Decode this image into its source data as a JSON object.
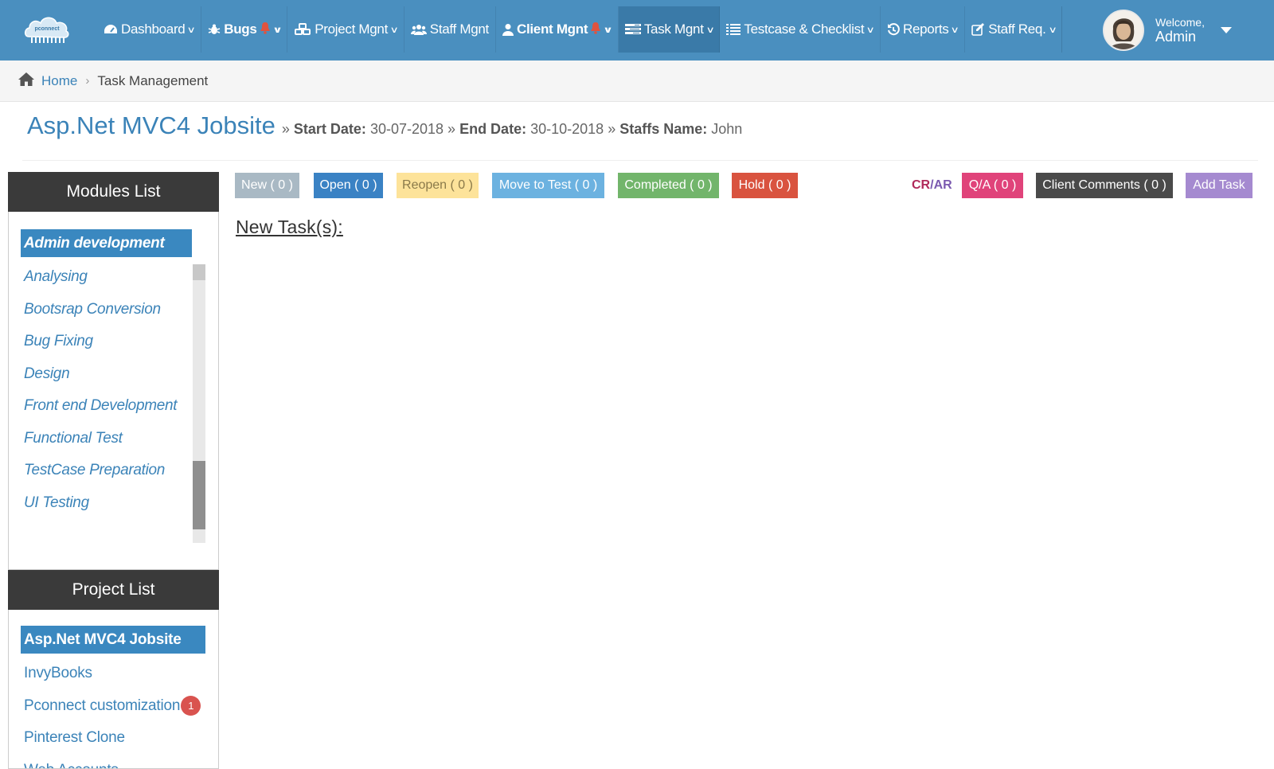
{
  "app": {
    "logo_text": "pconnect"
  },
  "nav": {
    "items": [
      {
        "label": "Dashboard",
        "icon": "dashboard-icon"
      },
      {
        "label": "Bugs",
        "icon": "bug-icon",
        "bell": true
      },
      {
        "label": "Project Mgnt",
        "icon": "cubes-icon"
      },
      {
        "label": "Staff Mgnt",
        "icon": "users-icon"
      },
      {
        "label": "Client Mgnt",
        "icon": "user-icon",
        "bell": true
      },
      {
        "label": "Task Mgnt",
        "icon": "tasks-icon",
        "active": true
      },
      {
        "label": "Testcase & Checklist",
        "icon": "list-icon"
      },
      {
        "label": "Reports",
        "icon": "history-icon"
      },
      {
        "label": "Staff Req.",
        "icon": "edit-icon"
      }
    ]
  },
  "user": {
    "welcome": "Welcome,",
    "name": "Admin"
  },
  "breadcrumb": {
    "home": "Home",
    "current": "Task Management"
  },
  "project": {
    "title": "Asp.Net MVC4 Jobsite",
    "start_label": "Start Date:",
    "start_date": "30-07-2018",
    "end_label": "End Date:",
    "end_date": "30-10-2018",
    "staff_label": "Staffs Name:",
    "staff_name": "John"
  },
  "status_buttons": [
    {
      "label": "New ( 0 )",
      "color": "#a9b9c4"
    },
    {
      "label": "Open ( 0 )",
      "color": "#3a82c4"
    },
    {
      "label": "Reopen ( 0 )",
      "color": "#fde39a",
      "text_color": "#8a7a4a"
    },
    {
      "label": "Move to Test ( 0 )",
      "color": "#6cb2e0"
    },
    {
      "label": "Completed ( 0 )",
      "color": "#72b56b"
    },
    {
      "label": "Hold ( 0 )",
      "color": "#d9533f"
    }
  ],
  "crar": {
    "cr": "CR",
    "slash": "/",
    "ar": "AR",
    "cr_color": "#b02a5a",
    "ar_color": "#7b5ab0"
  },
  "right_buttons": [
    {
      "label": "Q/A ( 0 )",
      "color": "#e0437a"
    },
    {
      "label": "Client Comments ( 0 )",
      "color": "#4a4a4a"
    },
    {
      "label": "Add Task",
      "color": "#a58ad0"
    }
  ],
  "section_heading": "New Task(s):",
  "modules": {
    "title": "Modules List",
    "items": [
      "Admin development",
      "Analysing",
      "Bootsrap Conversion",
      "Bug Fixing",
      "Design",
      "Front end Development",
      "Functional Test",
      "TestCase Preparation",
      "UI Testing"
    ],
    "selected": 0
  },
  "projects": {
    "title": "Project List",
    "items": [
      {
        "name": "Asp.Net MVC4 Jobsite",
        "selected": true
      },
      {
        "name": "InvyBooks"
      },
      {
        "name": "Pconnect customization",
        "badge": "1"
      },
      {
        "name": "Pinterest Clone"
      },
      {
        "name": "Web Accounts"
      }
    ]
  }
}
